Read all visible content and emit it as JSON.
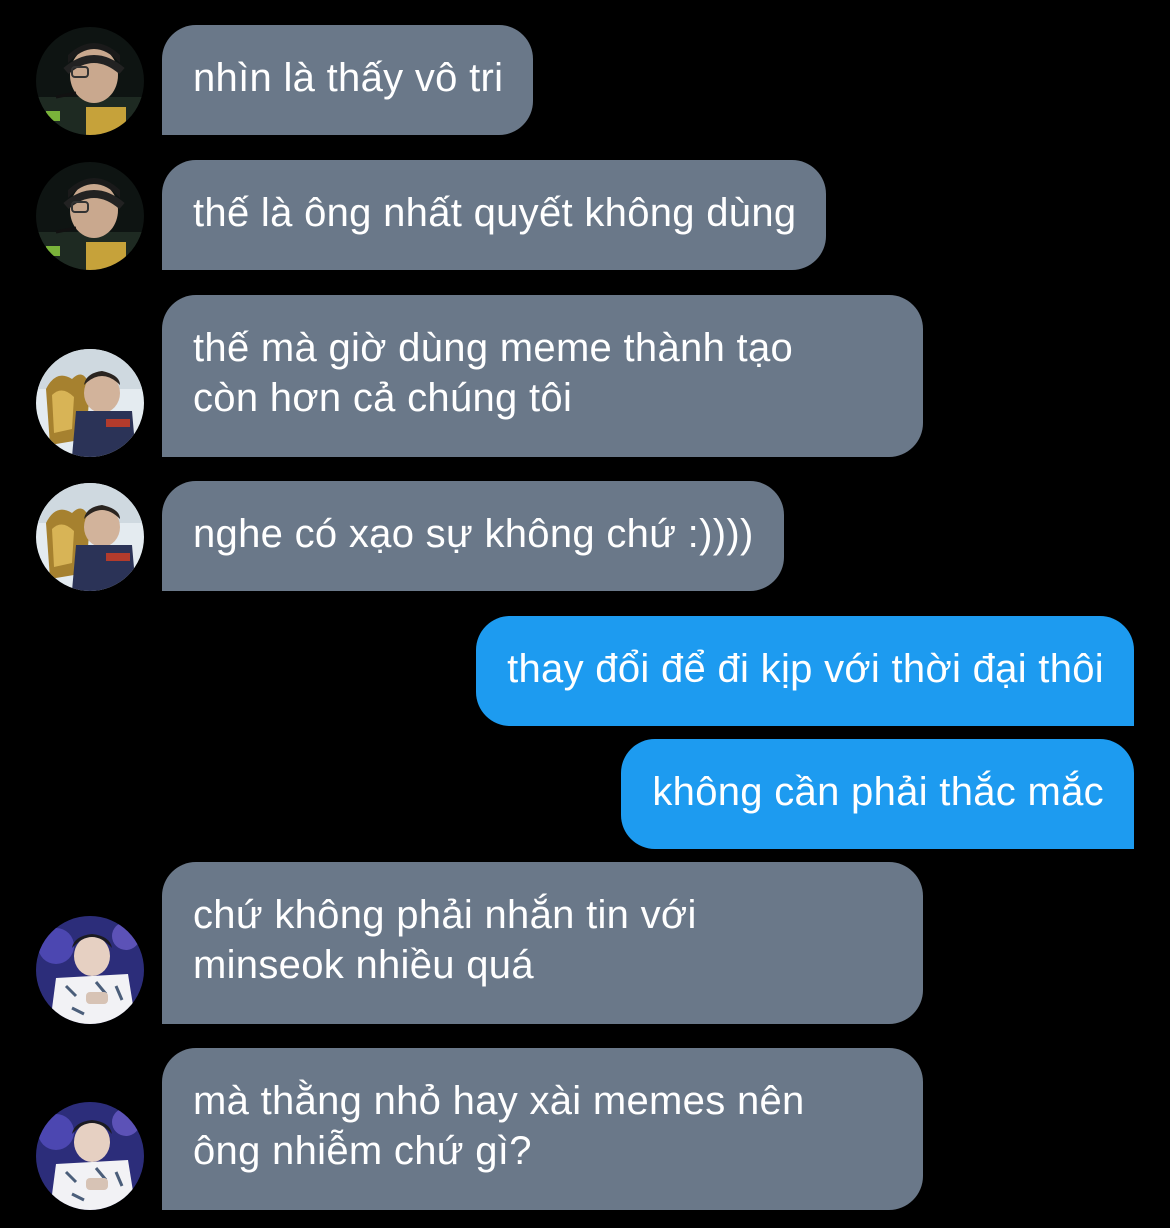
{
  "conversation": {
    "messages": [
      {
        "direction": "incoming",
        "avatar": "avatar-a",
        "text": "nhìn là thấy vô tri"
      },
      {
        "direction": "incoming",
        "avatar": "avatar-a",
        "text": "thế là ông nhất quyết không dùng"
      },
      {
        "direction": "incoming",
        "avatar": "avatar-b",
        "text": "thế mà giờ dùng meme thành tạo\ncòn hơn cả chúng tôi"
      },
      {
        "direction": "incoming",
        "avatar": "avatar-b",
        "text": "nghe có xạo sự không chứ :))))"
      },
      {
        "direction": "outgoing",
        "text": "thay đổi để đi kịp với thời đại thôi"
      },
      {
        "direction": "outgoing",
        "text": "không cần phải thắc mắc"
      },
      {
        "direction": "incoming",
        "avatar": "avatar-c",
        "text": "chứ không phải nhắn tin với\nminseok nhiều quá"
      },
      {
        "direction": "incoming",
        "avatar": "avatar-c",
        "text": "mà thằng nhỏ hay xài memes nên\nông nhiễm chứ gì?"
      }
    ]
  },
  "colors": {
    "background": "#000000",
    "incoming_bubble": "#6a7889",
    "outgoing_bubble": "#1d9bf0",
    "text": "#ffffff"
  }
}
